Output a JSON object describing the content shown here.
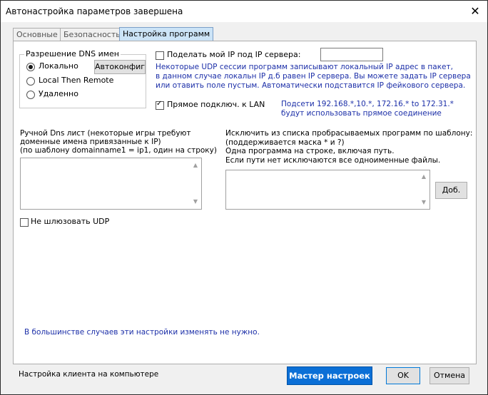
{
  "window": {
    "title": "Автонастройка параметров завершена",
    "close_glyph": "✕"
  },
  "tabs": [
    {
      "label": "Основные"
    },
    {
      "label": "Безопасность"
    },
    {
      "label": "Настройка программ"
    }
  ],
  "dns": {
    "title": "Разрешение DNS имен",
    "options": [
      "Локально",
      "Local Then Remote",
      "Удаленно"
    ],
    "selected": "Локально",
    "autoconfig_button": "Автоконфиг"
  },
  "share_ip": {
    "label": "Поделать мой IP под IP сервера:",
    "checked": false,
    "value": "",
    "description": [
      "Некоторые UDP сессии программ записывают локальный IP адрес в пакет,",
      "в данном случае локальн IP д.б равен IP сервера. Вы можете задать IP сервера",
      "или отавить поле пустым. Автоматически подставится IP фейкового сервера."
    ]
  },
  "lan": {
    "label": "Прямое подключ. к LAN",
    "checked": true,
    "note": [
      "Подсети 192.168.*,10.*, 172.16.* to 172.31.*",
      "будут использовать прямое соединение"
    ]
  },
  "dns_list": {
    "caption": [
      "Ручной Dns лист (некоторые игры требуют",
      "доменные имена привязанные к IP)",
      "(по шаблону domainname1 = ip1, один на строку)"
    ],
    "value": ""
  },
  "exclude": {
    "caption": [
      "Исключить из списка пробрасываемых программ по шаблону:",
      "(поддерживается маска * и ?)",
      "Одна программа на строке, включая путь.",
      "Если пути нет исключаются все одноименные файлы."
    ],
    "value": "",
    "add_button": "Доб."
  },
  "no_udp": {
    "label": "Не шлюзовать UDP",
    "checked": false
  },
  "footer_hint": "В большинстве случаев эти настройки изменять не нужно.",
  "bottom": {
    "status": "Настройка клиента на компьютере",
    "wizard_button": "Мастер настроек",
    "ok_button": "OK",
    "cancel_button": "Отмена"
  },
  "colors": {
    "accent": "#0b6fd6",
    "hint_text": "#1c2fa8",
    "active_tab": "#cce4f7"
  }
}
